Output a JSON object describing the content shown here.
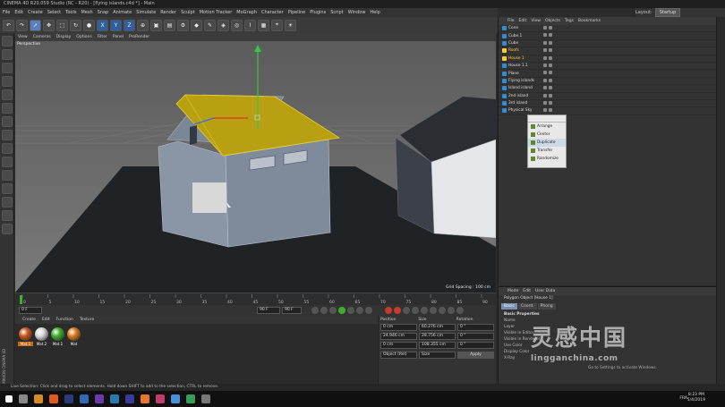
{
  "window": {
    "title": "CINEMA 4D R20.059 Studio (RC - R20) - [flying islands.c4d *] - Main"
  },
  "menubar": [
    "File",
    "Edit",
    "Create",
    "Select",
    "Tools",
    "Mesh",
    "Snap",
    "Animate",
    "Simulate",
    "Render",
    "Sculpt",
    "Motion Tracker",
    "MoGraph",
    "Character",
    "Pipeline",
    "Plugins",
    "Script",
    "Window",
    "Help"
  ],
  "layout": {
    "label": "Layout:",
    "value": "Startup"
  },
  "toolbar": {
    "axis_x": "X",
    "axis_y": "Y",
    "axis_z": "Z"
  },
  "viewport": {
    "menu": [
      "View",
      "Cameras",
      "Display",
      "Options",
      "Filter",
      "Panel",
      "ProRender"
    ],
    "camera_label": "Perspective",
    "grid_spacing": "Grid Spacing : 100 cm"
  },
  "timeline": {
    "ticks": [
      "0",
      "5",
      "10",
      "15",
      "20",
      "25",
      "30",
      "35",
      "40",
      "45",
      "50",
      "55",
      "60",
      "65",
      "70",
      "75",
      "80",
      "85",
      "90"
    ],
    "start_frame": "0 F",
    "current_frame": "0 F",
    "end_frame": "90 F",
    "max_frame": "90 F"
  },
  "material_manager": {
    "menu": [
      "Create",
      "Edit",
      "Function",
      "Texture"
    ],
    "materials": [
      {
        "label": "Mat.1",
        "color": "#c9551e"
      },
      {
        "label": "Mat.2",
        "color": "#d9d9d9"
      },
      {
        "label": "Mat.1",
        "color": "#3fae2c"
      },
      {
        "label": "Mat",
        "color": "#d9781e"
      }
    ]
  },
  "coordinates": {
    "headers": [
      "Position",
      "Size",
      "Rotation"
    ],
    "rows": [
      {
        "pos": "0 cm",
        "size": "60.276 cm",
        "rot": "0 °"
      },
      {
        "pos": "24.946 cm",
        "size": "28.756 cm",
        "rot": "0 °"
      },
      {
        "pos": "0 cm",
        "size": "108.355 cm",
        "rot": "0 °"
      }
    ],
    "mode": "Object (Rel)",
    "size_mode": "Size",
    "apply": "Apply"
  },
  "object_manager": {
    "menu": [
      "File",
      "Edit",
      "View",
      "Objects",
      "Tags",
      "Bookmarks"
    ],
    "objects": [
      {
        "name": "Cone",
        "color": "#2f8fd6",
        "highlight": false
      },
      {
        "name": "Cube.1",
        "color": "#2f8fd6",
        "highlight": false
      },
      {
        "name": "Cube",
        "color": "#2f8fd6",
        "highlight": false
      },
      {
        "name": "Roofs",
        "color": "#ffcc33",
        "highlight": true
      },
      {
        "name": "House 1",
        "color": "#ffcc33",
        "highlight": true
      },
      {
        "name": "House 1.1",
        "color": "#2f8fd6",
        "highlight": false
      },
      {
        "name": "Plane",
        "color": "#2f8fd6",
        "highlight": false
      },
      {
        "name": "Flying islands",
        "color": "#2f8fd6",
        "highlight": false
      },
      {
        "name": "Island island",
        "color": "#2f8fd6",
        "highlight": false
      },
      {
        "name": "2nd island",
        "color": "#2f8fd6",
        "highlight": false
      },
      {
        "name": "3rd island",
        "color": "#2f8fd6",
        "highlight": false
      },
      {
        "name": "Physical Sky",
        "color": "#2f8fd6",
        "highlight": false
      }
    ]
  },
  "popup": {
    "items": [
      "Arrange",
      "Center",
      "Duplicate",
      "Transfer",
      "Randomize"
    ]
  },
  "attributes": {
    "menu": [
      "Mode",
      "Edit",
      "User Data"
    ],
    "object_label": "Polygon Object [House 1]",
    "tabs": [
      "Basic",
      "Coord.",
      "Phong"
    ],
    "section": "Basic Properties",
    "fields": [
      "Name",
      "Layer",
      "Visible in Editor",
      "Visible in Renderer",
      "Use Color",
      "Display Color",
      "X-Ray"
    ]
  },
  "status": {
    "text": "Live Selection: Click and drag to select elements. Hold down SHIFT to add to the selection, CTRL to remove."
  },
  "watermark": {
    "main": "灵感中国",
    "sub": "lingganchina.com",
    "activate": "Go to Settings to activate Windows."
  },
  "taskbar": {
    "time": "8:23 PM",
    "date": "5/4/2019",
    "lang": "FRA"
  },
  "side_label": "MAXON CINEMA 4D"
}
